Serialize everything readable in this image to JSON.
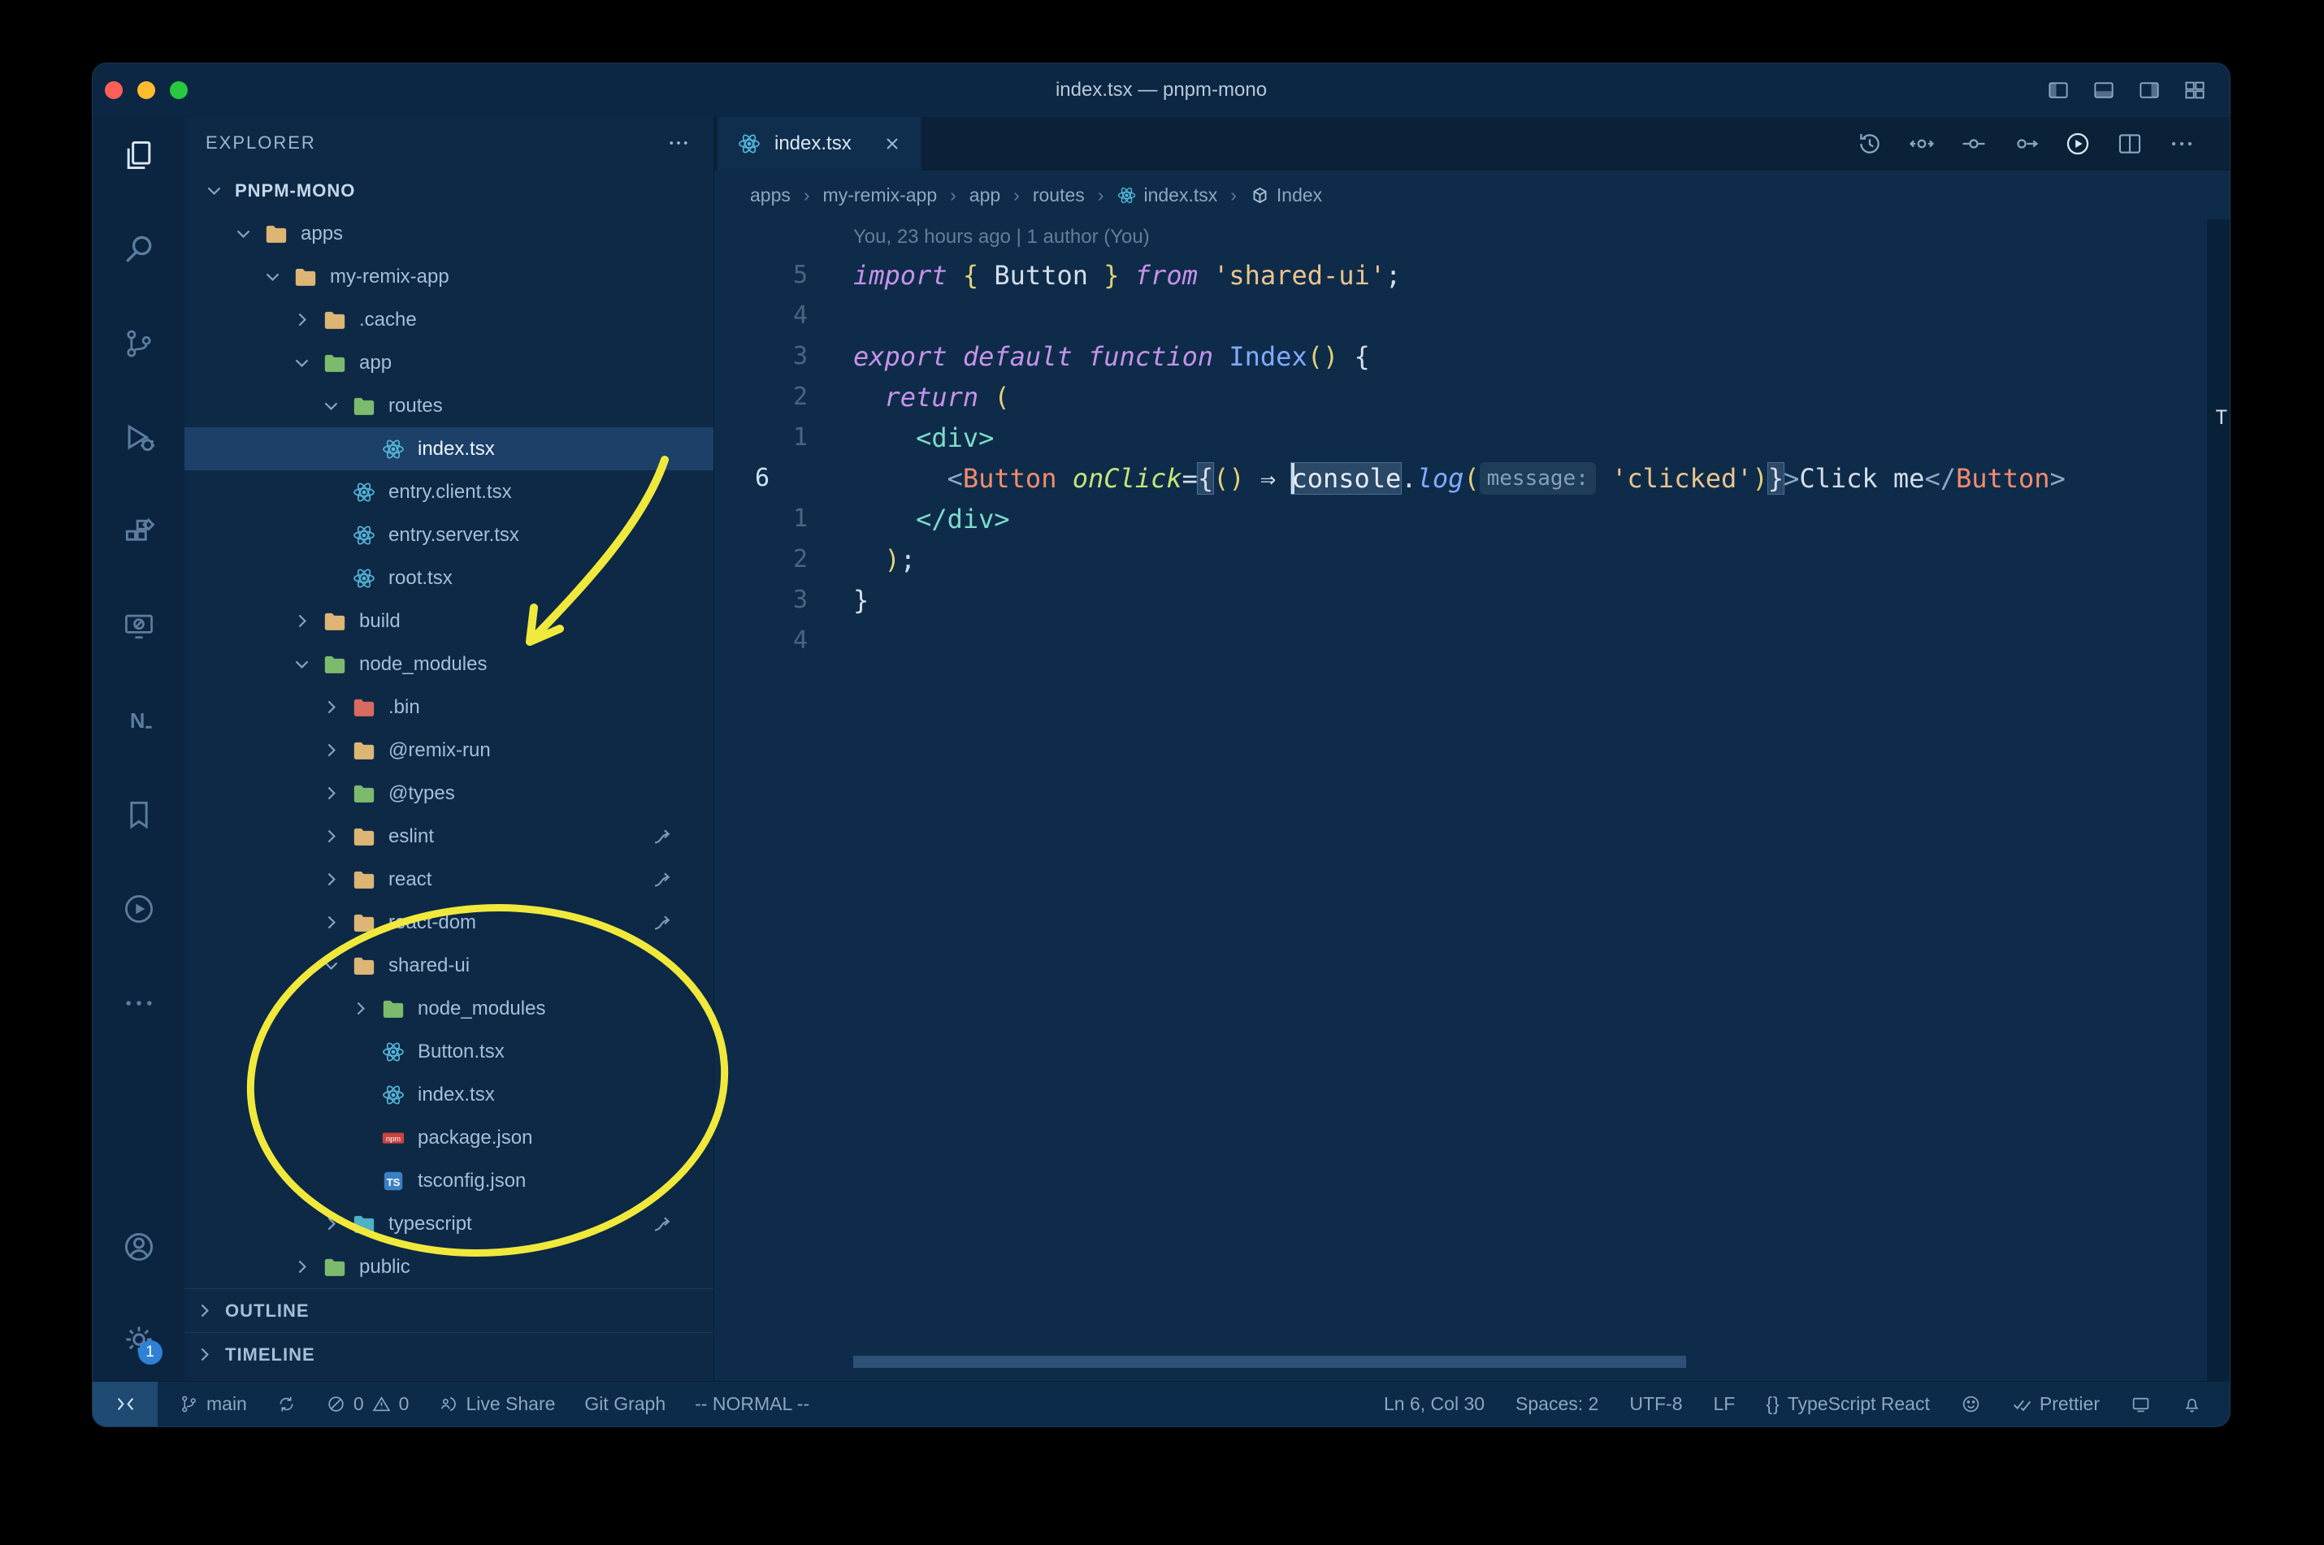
{
  "window": {
    "title": "index.tsx — pnpm-mono"
  },
  "activity_bar": {
    "badge": "1"
  },
  "explorer": {
    "header": "EXPLORER",
    "sections": [
      "OUTLINE",
      "TIMELINE"
    ],
    "items": [
      {
        "label": "PNPM-MONO",
        "depth": 0,
        "kind": "root",
        "expanded": true
      },
      {
        "label": "apps",
        "depth": 1,
        "kind": "folder",
        "icon": "folder-orange",
        "expanded": true
      },
      {
        "label": "my-remix-app",
        "depth": 2,
        "kind": "folder",
        "icon": "folder-orange",
        "expanded": true
      },
      {
        "label": ".cache",
        "depth": 3,
        "kind": "folder",
        "icon": "folder-orange",
        "expanded": false
      },
      {
        "label": "app",
        "depth": 3,
        "kind": "folder",
        "icon": "folder-green",
        "expanded": true
      },
      {
        "label": "routes",
        "depth": 4,
        "kind": "folder",
        "icon": "folder-green",
        "expanded": true
      },
      {
        "label": "index.tsx",
        "depth": 5,
        "kind": "file",
        "icon": "react",
        "selected": true
      },
      {
        "label": "entry.client.tsx",
        "depth": 4,
        "kind": "file",
        "icon": "react"
      },
      {
        "label": "entry.server.tsx",
        "depth": 4,
        "kind": "file",
        "icon": "react"
      },
      {
        "label": "root.tsx",
        "depth": 4,
        "kind": "file",
        "icon": "react"
      },
      {
        "label": "build",
        "depth": 3,
        "kind": "folder",
        "icon": "folder-orange",
        "expanded": false
      },
      {
        "label": "node_modules",
        "depth": 3,
        "kind": "folder",
        "icon": "folder-green",
        "expanded": true
      },
      {
        "label": ".bin",
        "depth": 4,
        "kind": "folder",
        "icon": "folder-red",
        "expanded": false
      },
      {
        "label": "@remix-run",
        "depth": 4,
        "kind": "folder",
        "icon": "folder-orange",
        "expanded": false
      },
      {
        "label": "@types",
        "depth": 4,
        "kind": "folder",
        "icon": "folder-green",
        "expanded": false
      },
      {
        "label": "eslint",
        "depth": 4,
        "kind": "folder",
        "icon": "folder-orange",
        "expanded": false,
        "symlink": true
      },
      {
        "label": "react",
        "depth": 4,
        "kind": "folder",
        "icon": "folder-orange",
        "expanded": false,
        "symlink": true
      },
      {
        "label": "react-dom",
        "depth": 4,
        "kind": "folder",
        "icon": "folder-orange",
        "expanded": false,
        "symlink": true
      },
      {
        "label": "shared-ui",
        "depth": 4,
        "kind": "folder",
        "icon": "folder-orange",
        "expanded": true
      },
      {
        "label": "node_modules",
        "depth": 5,
        "kind": "folder",
        "icon": "folder-green",
        "expanded": false
      },
      {
        "label": "Button.tsx",
        "depth": 5,
        "kind": "file",
        "icon": "react"
      },
      {
        "label": "index.tsx",
        "depth": 5,
        "kind": "file",
        "icon": "react"
      },
      {
        "label": "package.json",
        "depth": 5,
        "kind": "file",
        "icon": "npm"
      },
      {
        "label": "tsconfig.json",
        "depth": 5,
        "kind": "file",
        "icon": "ts"
      },
      {
        "label": "typescript",
        "depth": 4,
        "kind": "folder",
        "icon": "folder-blue",
        "expanded": false,
        "symlink": true
      },
      {
        "label": "public",
        "depth": 3,
        "kind": "folder",
        "icon": "folder-green",
        "expanded": false
      }
    ]
  },
  "tabs": [
    {
      "label": "index.tsx",
      "active": true
    }
  ],
  "breadcrumbs": {
    "separator": "›",
    "items": [
      "apps",
      "my-remix-app",
      "app",
      "routes",
      "index.tsx",
      "Index"
    ]
  },
  "editor": {
    "blame": "You, 23 hours ago | 1 author (You)",
    "minimap_char": "T",
    "lines": [
      {
        "num": "5",
        "tokens": [
          [
            "kw",
            "import"
          ],
          [
            "pn",
            " "
          ],
          [
            "br",
            "{"
          ],
          [
            "pn",
            " "
          ],
          [
            "var",
            "Button"
          ],
          [
            "pn",
            " "
          ],
          [
            "br",
            "}"
          ],
          [
            "pn",
            " "
          ],
          [
            "kw",
            "from"
          ],
          [
            "pn",
            " "
          ],
          [
            "str",
            "'shared-ui'"
          ],
          [
            "pn",
            ";"
          ]
        ]
      },
      {
        "num": "4",
        "tokens": []
      },
      {
        "num": "3",
        "tokens": [
          [
            "kw",
            "export"
          ],
          [
            "pn",
            " "
          ],
          [
            "kw",
            "default"
          ],
          [
            "pn",
            " "
          ],
          [
            "kw",
            "function"
          ],
          [
            "pn",
            " "
          ],
          [
            "fn",
            "Index"
          ],
          [
            "br",
            "()"
          ],
          [
            "pn",
            " {"
          ]
        ]
      },
      {
        "num": "2",
        "tokens": [
          [
            "pn",
            "  "
          ],
          [
            "kw",
            "return"
          ],
          [
            "pn",
            " "
          ],
          [
            "br",
            "("
          ]
        ]
      },
      {
        "num": "1",
        "tokens": [
          [
            "pn",
            "    "
          ],
          [
            "tag",
            "<div>"
          ]
        ]
      },
      {
        "num": "6",
        "current": true,
        "tokens": [
          [
            "pn",
            "      "
          ],
          [
            "tagb",
            "<"
          ],
          [
            "comp",
            "Button"
          ],
          [
            "pn",
            " "
          ],
          [
            "attr",
            "onClick"
          ],
          [
            "op",
            "="
          ],
          [
            "brhl",
            "{"
          ],
          [
            "br",
            "()"
          ],
          [
            "pn",
            " "
          ],
          [
            "op",
            "⇒"
          ],
          [
            "pn",
            " "
          ],
          [
            "sel",
            "console"
          ],
          [
            "pn",
            "."
          ],
          [
            "meth",
            "log"
          ],
          [
            "br",
            "("
          ],
          [
            "inlay",
            "message:"
          ],
          [
            "pn",
            " "
          ],
          [
            "str",
            "'clicked'"
          ],
          [
            "br",
            ")"
          ],
          [
            "brhl",
            "}"
          ],
          [
            "tagb",
            ">"
          ],
          [
            "txt",
            "Click me"
          ],
          [
            "tagb",
            "</"
          ],
          [
            "comp",
            "Button"
          ],
          [
            "tagb",
            ">"
          ]
        ]
      },
      {
        "num": "1",
        "tokens": [
          [
            "pn",
            "    "
          ],
          [
            "tag",
            "</div>"
          ]
        ]
      },
      {
        "num": "2",
        "tokens": [
          [
            "pn",
            "  "
          ],
          [
            "br",
            ")"
          ],
          [
            "pn",
            ";"
          ]
        ]
      },
      {
        "num": "3",
        "tokens": [
          [
            "pn",
            "}"
          ]
        ]
      },
      {
        "num": "4",
        "tokens": []
      }
    ]
  },
  "status_bar": {
    "branch": "main",
    "errors": "0",
    "warnings": "0",
    "live_share": "Live Share",
    "git_graph": "Git Graph",
    "vim_mode": "-- NORMAL --",
    "cursor": "Ln 6, Col 30",
    "spaces": "Spaces: 2",
    "encoding": "UTF-8",
    "eol": "LF",
    "language_icon": "{}",
    "language": "TypeScript React",
    "formatter": "Prettier"
  },
  "annotations": {
    "color": "#f0e93c"
  }
}
